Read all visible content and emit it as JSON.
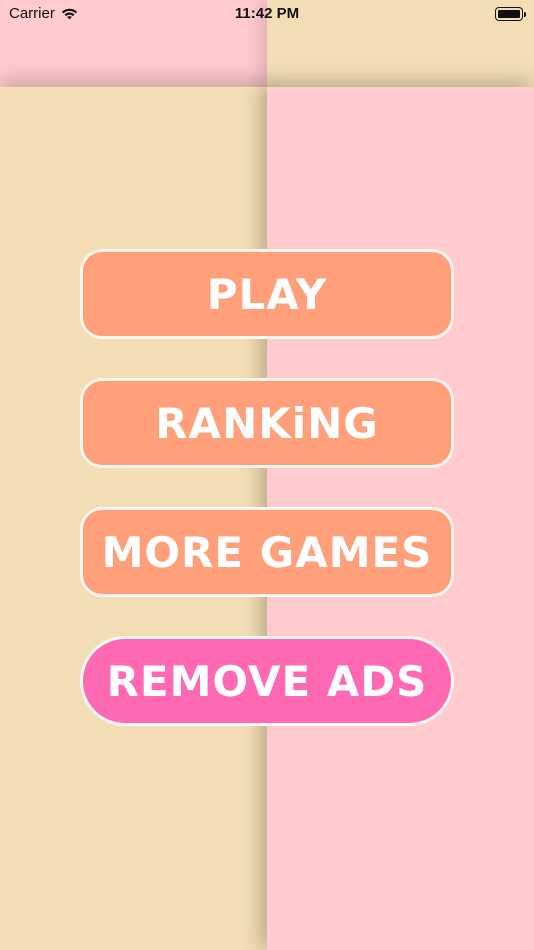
{
  "status_bar": {
    "carrier": "Carrier",
    "time": "11:42 PM",
    "wifi_icon": "wifi-icon",
    "battery_icon": "battery-full-icon"
  },
  "theme": {
    "pink": "#ffcbcf",
    "beige": "#f3ddb4",
    "button_orange": "#ffa07a",
    "button_pink": "#ff69b4",
    "button_text": "#ffffff"
  },
  "menu": {
    "play_label": "PLAY",
    "ranking_label": "RANKiNG",
    "more_games_label": "MORE GAMES",
    "remove_ads_label": "REMOVE ADS"
  }
}
